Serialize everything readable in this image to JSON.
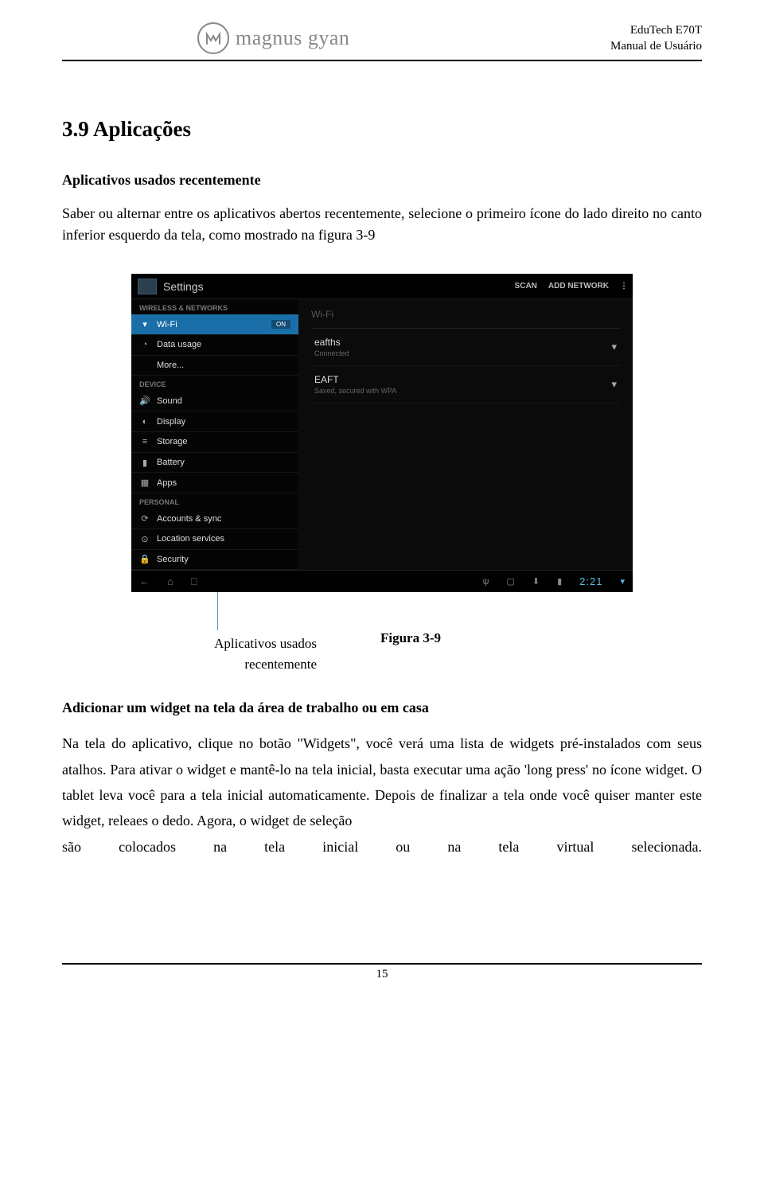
{
  "header": {
    "logo_text": "magnus gyan",
    "product": "EduTech E70T",
    "doc_title": "Manual de Usuário"
  },
  "section": {
    "number_title": "3.9  Aplicações",
    "sub1": "Aplicativos usados recentemente",
    "para1": "Saber ou alternar entre os aplicativos abertos recentemente, selecione o primeiro ícone do lado direito no canto inferior esquerdo da tela, como mostrado na figura 3-9"
  },
  "screenshot": {
    "title": "Settings",
    "scan": "SCAN",
    "add_network": "ADD NETWORK",
    "cat_wireless": "WIRELESS & NETWORKS",
    "cat_device": "DEVICE",
    "cat_personal": "PERSONAL",
    "items": {
      "wifi": "Wi-Fi",
      "wifi_state": "ON",
      "data_usage": "Data usage",
      "more": "More...",
      "sound": "Sound",
      "display": "Display",
      "storage": "Storage",
      "battery": "Battery",
      "apps": "Apps",
      "accounts": "Accounts & sync",
      "location": "Location services",
      "security": "Security"
    },
    "main_hdr": "Wi-Fi",
    "net1": {
      "name": "eafths",
      "sub": "Connected"
    },
    "net2": {
      "name": "EAFT",
      "sub": "Saved, secured with WPA"
    },
    "clock": "2:21"
  },
  "figure": {
    "callout": "Aplicativos usados recentemente",
    "caption": "Figura 3-9"
  },
  "section2": {
    "heading": "Adicionar um widget na tela da área de trabalho ou em casa",
    "para": "Na tela do aplicativo, clique no botão \"Widgets\", você verá uma lista de widgets pré-instalados com seus atalhos. Para ativar o widget e mantê-lo na tela inicial, basta executar uma ação 'long press' no ícone widget. O tablet leva você para a tela inicial automaticamente. Depois de finalizar a tela onde você quiser manter este widget, releaes o dedo. Agora, o widget de seleção",
    "last_words": [
      "são",
      "colocados",
      "na",
      "tela",
      "inicial",
      "ou",
      "na",
      "tela",
      "virtual",
      "selecionada."
    ]
  },
  "page_number": "15"
}
